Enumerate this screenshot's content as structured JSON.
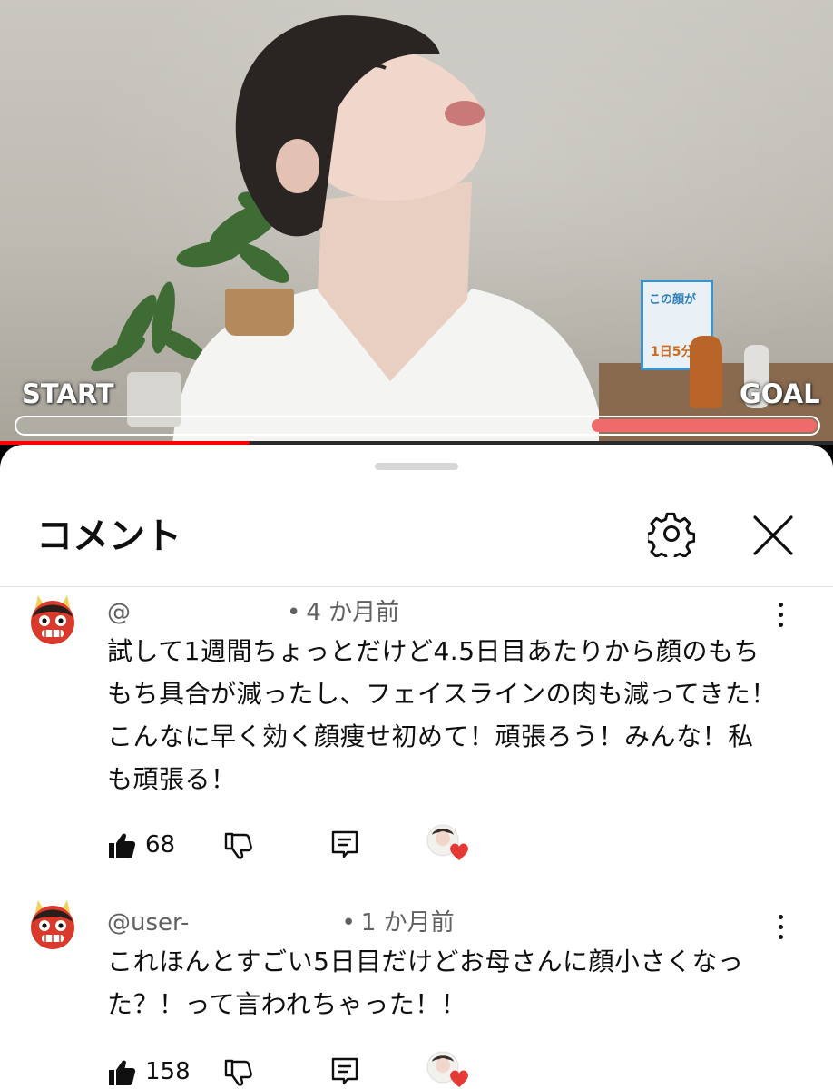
{
  "video": {
    "label_start": "START",
    "label_goal": "GOAL",
    "overlay_progress_fraction": 0.28,
    "player_played_fraction": 0.3,
    "book_title": "この顔が",
    "book_number": "1日5分"
  },
  "comments_panel": {
    "title": "コメント",
    "icons": {
      "settings": "gear-icon",
      "close": "close-icon"
    }
  },
  "comments": [
    {
      "handle": "@",
      "time": "4 か月前",
      "text": "試して1週間ちょっとだけど4.5日目あたりから顔のもちもち具合が減ったし、フェイスラインの肉も減ってきた！こんなに早く効く顔痩せ初めて！頑張ろう！みんな！私も頑張る！",
      "likes": "68",
      "creator_heart": true
    },
    {
      "handle": "@user-",
      "time": "1 か月前",
      "text": "これほんとすごい5日目だけどお母さんに顔小さくなった？！って言われちゃった！！",
      "likes": "158",
      "creator_heart": true
    }
  ],
  "colors": {
    "accent_red": "#ff0000",
    "progress_fill": "#ef6a6a",
    "heart": "#e53935",
    "meta_gray": "#606060"
  }
}
